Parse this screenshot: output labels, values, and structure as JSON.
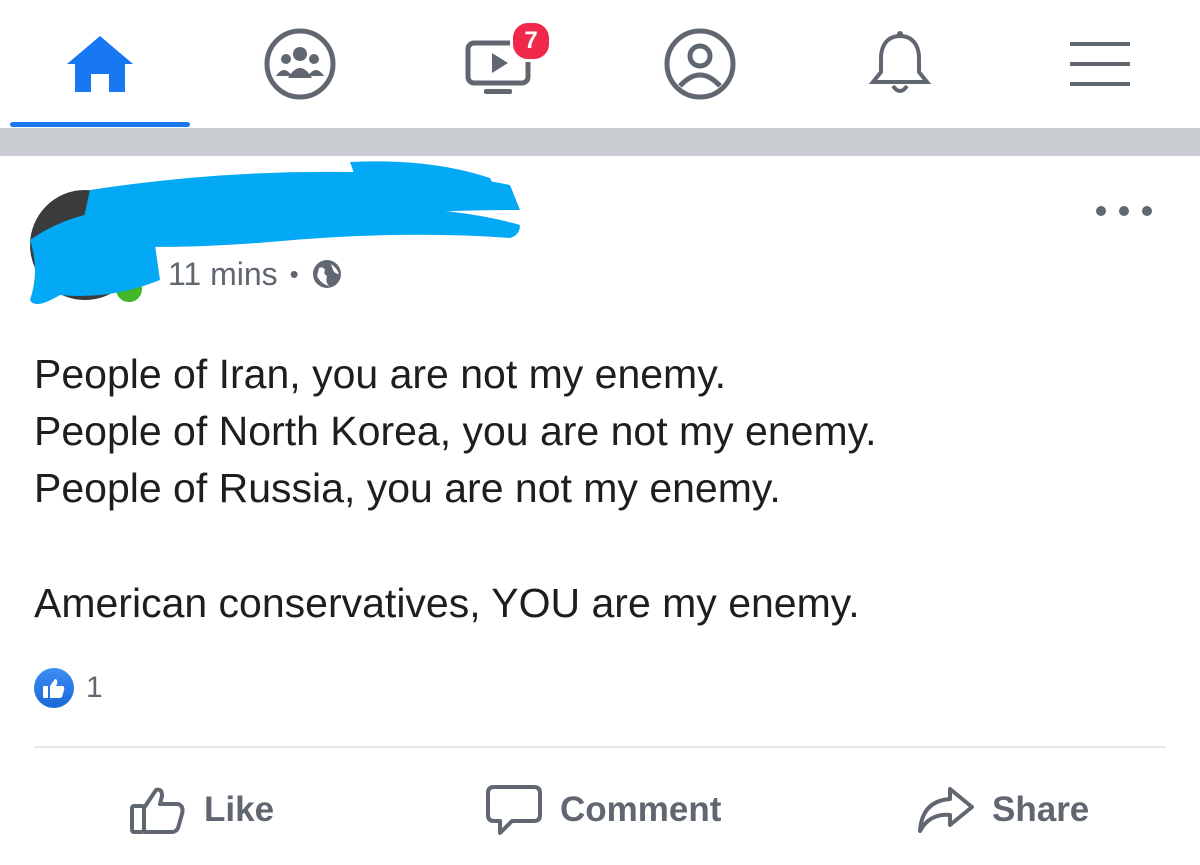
{
  "nav": {
    "tabs": [
      {
        "name": "home",
        "icon": "home-icon",
        "active": true
      },
      {
        "name": "groups",
        "icon": "groups-icon"
      },
      {
        "name": "watch",
        "icon": "video-icon",
        "badge": "7"
      },
      {
        "name": "profile",
        "icon": "profile-icon"
      },
      {
        "name": "notifications",
        "icon": "bell-icon"
      },
      {
        "name": "menu",
        "icon": "hamburger-menu-icon"
      }
    ],
    "accent_color": "#1877f2",
    "badge_color": "#f02849"
  },
  "post": {
    "timestamp": "11 mins",
    "separator": "•",
    "audience_icon": "globe-icon",
    "more_icon": "more-dots-icon",
    "lines": [
      "People of Iran, you are not my enemy.",
      "People of North Korea, you are not my enemy.",
      "People of Russia, you are not my enemy.",
      "American conservatives, YOU are my enemy."
    ],
    "reaction_count": "1",
    "reaction_icon": "like-reaction-icon"
  },
  "actions": {
    "like": "Like",
    "comment": "Comment",
    "share": "Share"
  }
}
